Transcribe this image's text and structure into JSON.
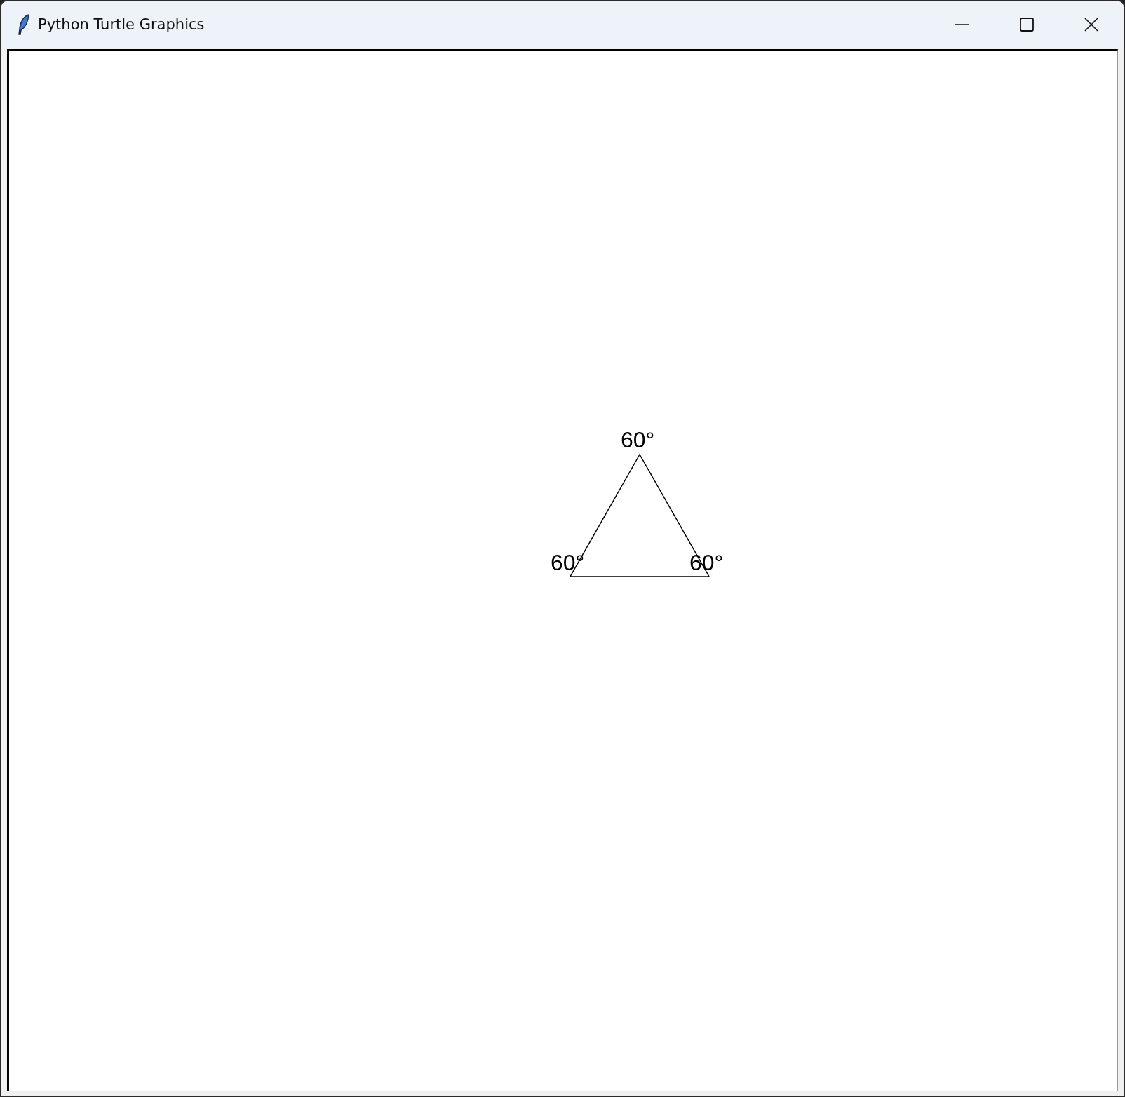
{
  "window": {
    "title": "Python Turtle Graphics"
  },
  "canvas": {
    "labels": [
      {
        "text": "60°"
      },
      {
        "text": "60°"
      },
      {
        "text": "60°"
      }
    ]
  }
}
